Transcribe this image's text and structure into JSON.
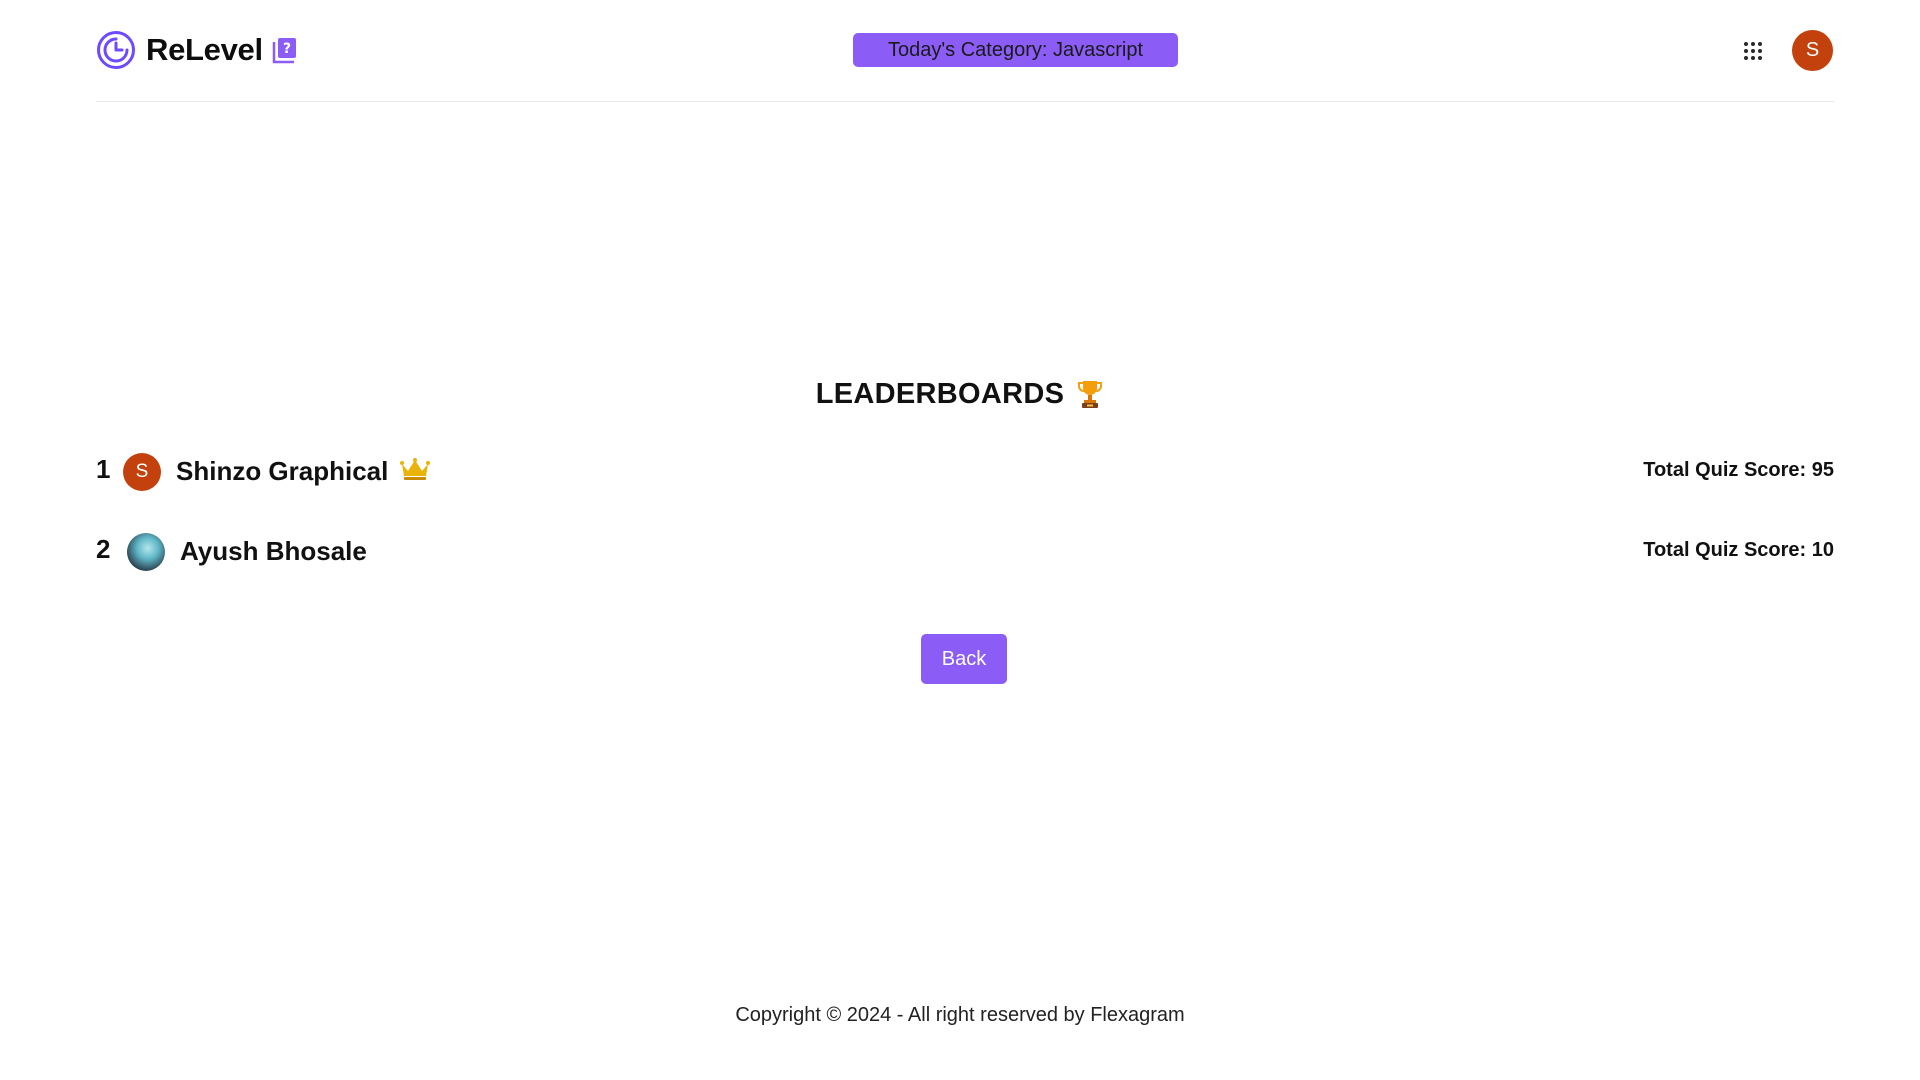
{
  "header": {
    "brand_name": "ReLevel",
    "category_label": "Today's Category: Javascript",
    "avatar_initial": "S",
    "logo_icon": "relevel-logo-icon",
    "quiz_icon": "quiz-badge-icon",
    "apps_icon": "apps-grid-icon"
  },
  "leaderboard": {
    "title": "LEADERBOARDS",
    "title_icon": "trophy-icon",
    "entries": [
      {
        "rank": "1",
        "avatar_initial": "S",
        "name": "Shinzo Graphical",
        "score_label": "Total Quiz Score: 95",
        "badge_icon": "crown-icon"
      },
      {
        "rank": "2",
        "avatar_initial": "",
        "name": "Ayush Bhosale",
        "score_label": "Total Quiz Score: 10"
      }
    ]
  },
  "back_button_label": "Back",
  "footer": {
    "copyright": "Copyright © 2024 - All right reserved by Flexagram"
  },
  "colors": {
    "accent": "#8b5cf6",
    "avatar": "#c2410c",
    "crown": "#eab308",
    "text": "#111111"
  }
}
